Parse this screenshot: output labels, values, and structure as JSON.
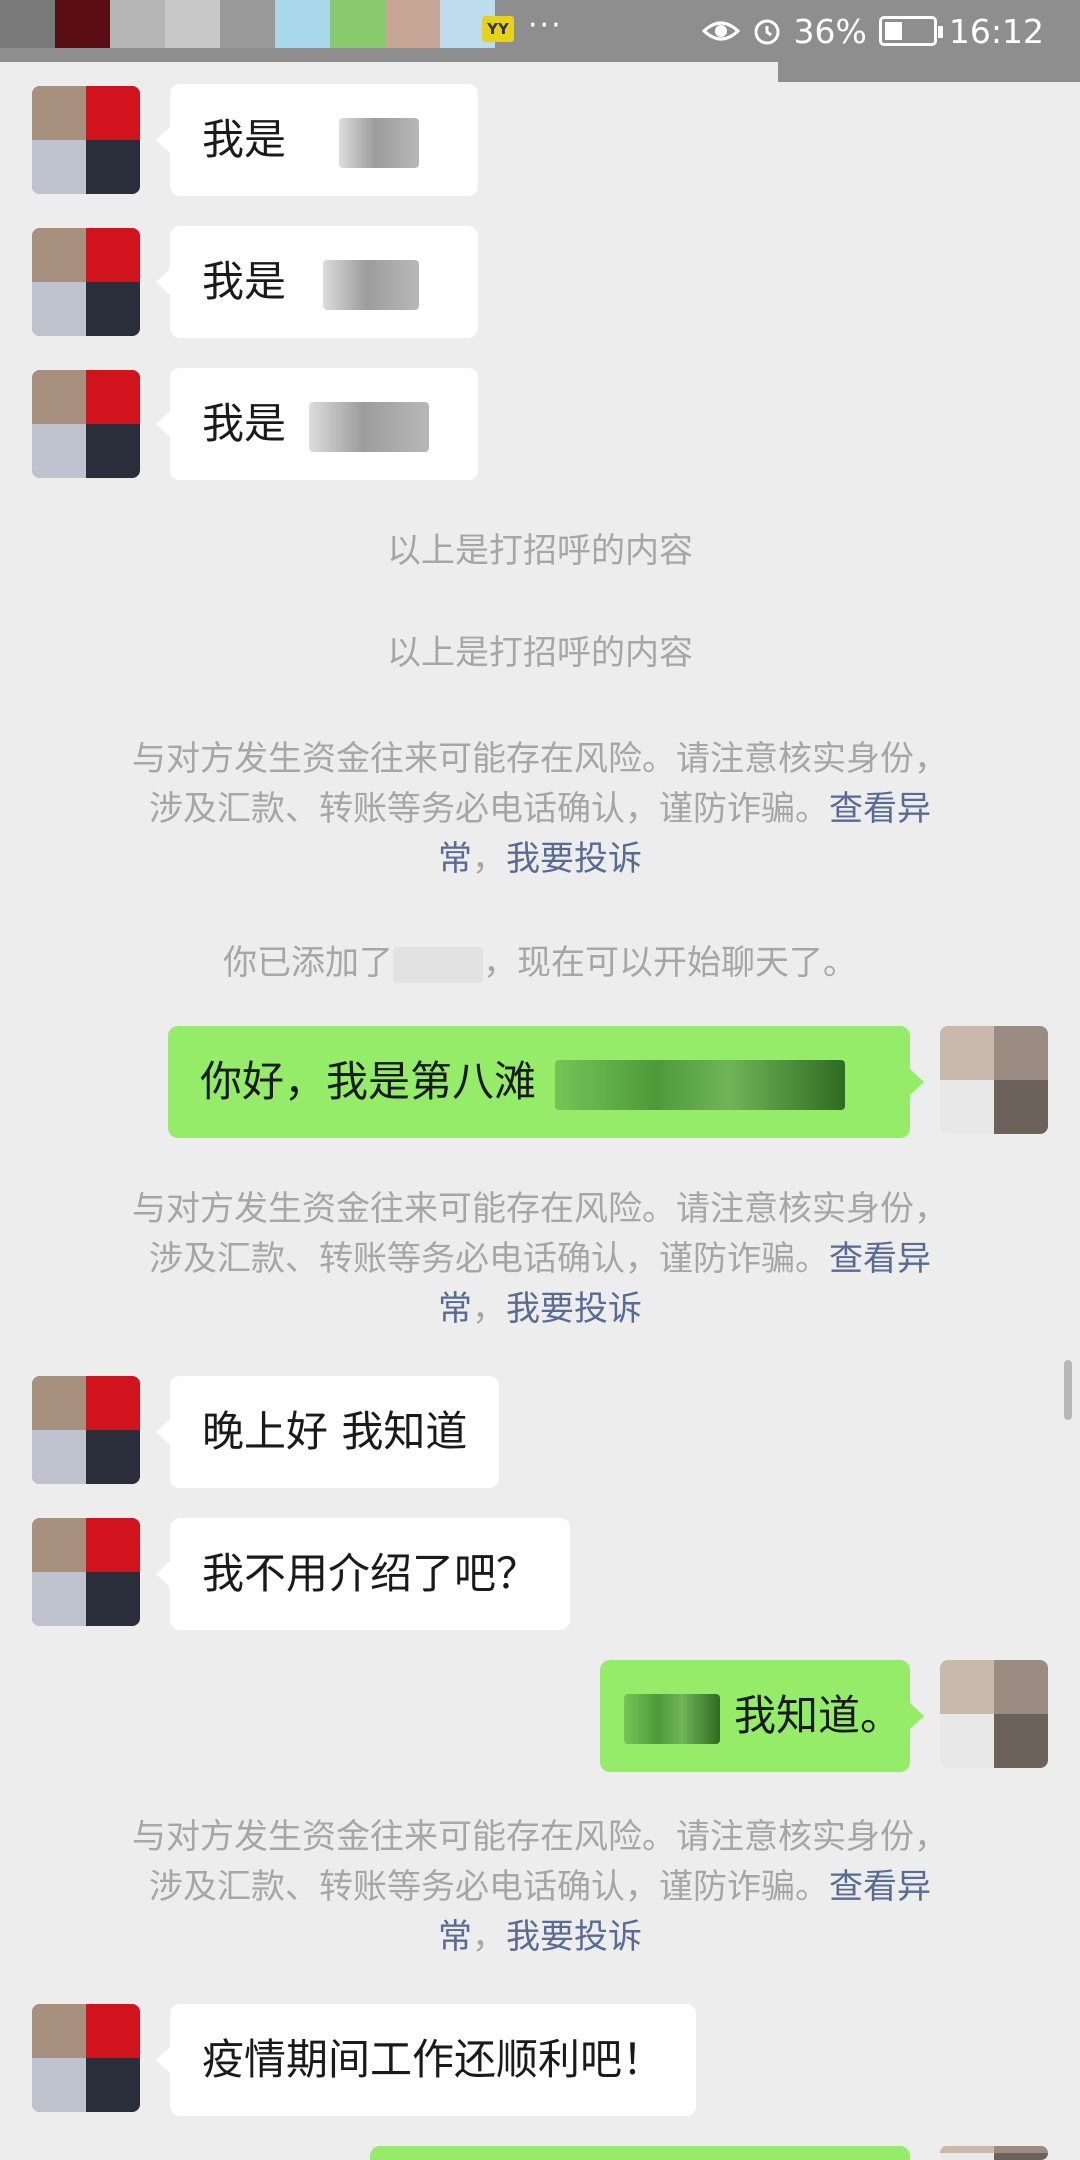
{
  "status_bar": {
    "notification_colors": [
      "#7a7a7a",
      "#5a0d12",
      "#b5b5b5",
      "#c8c8c8",
      "#9a9a9a",
      "#a9d8ea",
      "#8bc96e",
      "#c7a695",
      "#bfdcef"
    ],
    "yy_label": "YY",
    "more": "···",
    "battery": "36%",
    "battery_level": 0.36,
    "time": "16:12"
  },
  "chat": {
    "greetings": [
      {
        "text": "我是"
      },
      {
        "text": "我是"
      },
      {
        "text": "我是"
      }
    ],
    "greeting_notice_1": "以上是打招呼的内容",
    "greeting_notice_2": "以上是打招呼的内容",
    "risk_notice": {
      "line1": "与对方发生资金往来可能存在风险。请注意核实身份，",
      "line2_text": "涉及汇款、转账等务必电话确认，谨防诈骗。",
      "line2_link": "查看异",
      "line3_link_a": "常",
      "sep": "，",
      "line3_link_b": "我要投诉"
    },
    "added_notice_prefix": "你已添加了",
    "added_notice_suffix": "，现在可以开始聊天了。",
    "msg_self_1": "你好，我是第八滩",
    "msg_other_1": "晚上好  我知道",
    "msg_other_2": "我不用介绍了吧？",
    "msg_self_2": "我知道。",
    "msg_other_3": "疫情期间工作还顺利吧！"
  }
}
